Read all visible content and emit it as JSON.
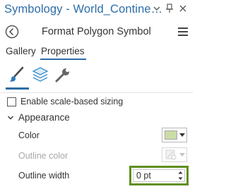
{
  "window": {
    "title": "Symbology - World_Contine…",
    "pin_icon": "pin-icon",
    "close_icon": "close-icon",
    "dropdown_icon": "chevron-down-icon"
  },
  "header": {
    "title": "Format Polygon Symbol",
    "back_icon": "back-arrow-icon",
    "menu_icon": "hamburger-menu-icon"
  },
  "tabs": [
    {
      "label": "Gallery",
      "selected": false
    },
    {
      "label": "Properties",
      "selected": true
    }
  ],
  "subtabs": [
    {
      "icon": "paintbrush-icon",
      "selected": true
    },
    {
      "icon": "layers-icon",
      "selected": false
    },
    {
      "icon": "wrench-icon",
      "selected": false
    }
  ],
  "scale_sizing": {
    "label": "Enable scale-based sizing",
    "checked": false
  },
  "appearance": {
    "label": "Appearance",
    "expanded": true,
    "color": {
      "label": "Color",
      "value": "#cbdca6"
    },
    "outline_color": {
      "label": "Outline color",
      "enabled": false
    },
    "outline_width": {
      "label": "Outline width",
      "value": "0 pt"
    }
  },
  "colors": {
    "accent": "#2d6da8",
    "highlight": "#5e8f1f",
    "swatch": "#cbdca6"
  }
}
